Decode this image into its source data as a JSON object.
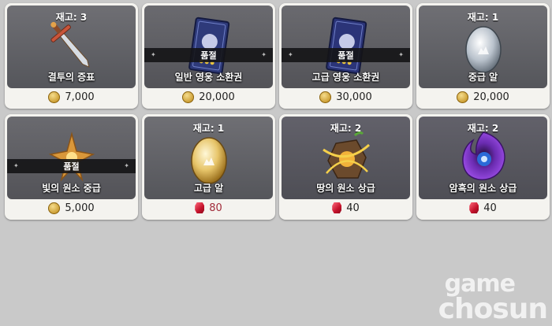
{
  "shop": {
    "items": [
      {
        "stock": "재고: 3",
        "name": "결투의 증표",
        "price": "7,000",
        "currency": "gold",
        "soldout": false
      },
      {
        "stock": "",
        "name": "일반 영웅 소환권",
        "price": "20,000",
        "currency": "gold",
        "soldout": true,
        "soldout_label": "품절"
      },
      {
        "stock": "",
        "name": "고급 영웅 소환권",
        "price": "30,000",
        "currency": "gold",
        "soldout": true,
        "soldout_label": "품절"
      },
      {
        "stock": "재고: 1",
        "name": "중급 알",
        "price": "20,000",
        "currency": "gold",
        "soldout": false
      },
      {
        "stock": "",
        "name": "빛의 원소 중급",
        "price": "5,000",
        "currency": "gold",
        "soldout": true,
        "soldout_label": "품절"
      },
      {
        "stock": "재고: 1",
        "name": "고급 알",
        "price": "80",
        "currency": "ruby",
        "soldout": false
      },
      {
        "stock": "재고: 2",
        "name": "땅의 원소 상급",
        "price": "40",
        "currency": "ruby",
        "soldout": false
      },
      {
        "stock": "재고: 2",
        "name": "암흑의 원소 상급",
        "price": "40",
        "currency": "ruby",
        "soldout": false
      }
    ]
  },
  "icons": [
    "sword-icon",
    "summon-card-icon",
    "summon-card-icon",
    "silver-egg-icon",
    "light-element-icon",
    "gold-egg-icon",
    "earth-element-icon",
    "dark-element-icon",
    "gold-coin-icon",
    "ruby-icon"
  ],
  "colors": {
    "card_bg": "#f4f3ef",
    "art_bg": "#5f5f64",
    "ruby_price": "#a12b3a",
    "page_bg": "#c9c9c9"
  },
  "watermark": {
    "line1": "game",
    "line2": "chosun"
  }
}
